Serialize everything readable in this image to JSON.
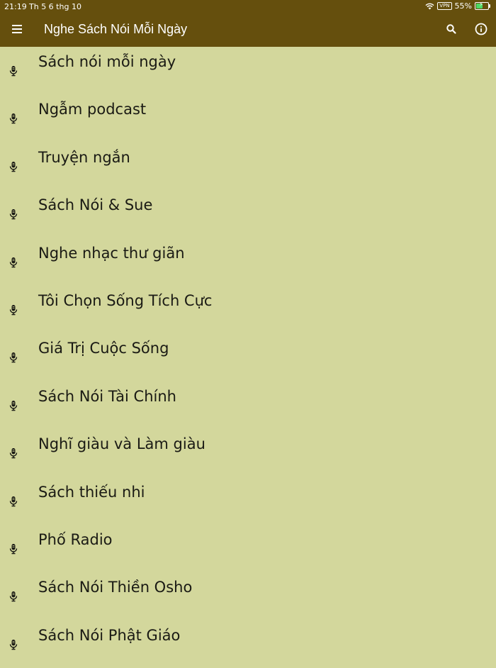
{
  "status_bar": {
    "time": "21:19",
    "date": "Th 5 6 thg 10",
    "vpn": "VPN",
    "battery": "55%",
    "battery_level": 0.55
  },
  "app_bar": {
    "title": "Nghe Sách Nói Mỗi Ngày",
    "menu_icon": "menu-icon",
    "search_icon": "search-icon",
    "info_icon": "info-icon",
    "color": "#654f0d"
  },
  "list": {
    "background": "#d3d79c",
    "item_icon": "microphone-icon",
    "items": [
      {
        "label": "Sách nói mỗi ngày"
      },
      {
        "label": "Ngẫm podcast"
      },
      {
        "label": "Truyện ngắn"
      },
      {
        "label": "Sách Nói & Sue"
      },
      {
        "label": "Nghe nhạc thư giãn"
      },
      {
        "label": "Tôi Chọn Sống Tích Cực"
      },
      {
        "label": "Giá Trị Cuộc Sống"
      },
      {
        "label": "Sách Nói Tài Chính"
      },
      {
        "label": "Nghĩ giàu và Làm giàu"
      },
      {
        "label": "Sách thiếu nhi"
      },
      {
        "label": "Phố Radio"
      },
      {
        "label": "Sách Nói Thiền Osho"
      },
      {
        "label": "Sách Nói Phật Giáo"
      }
    ]
  }
}
